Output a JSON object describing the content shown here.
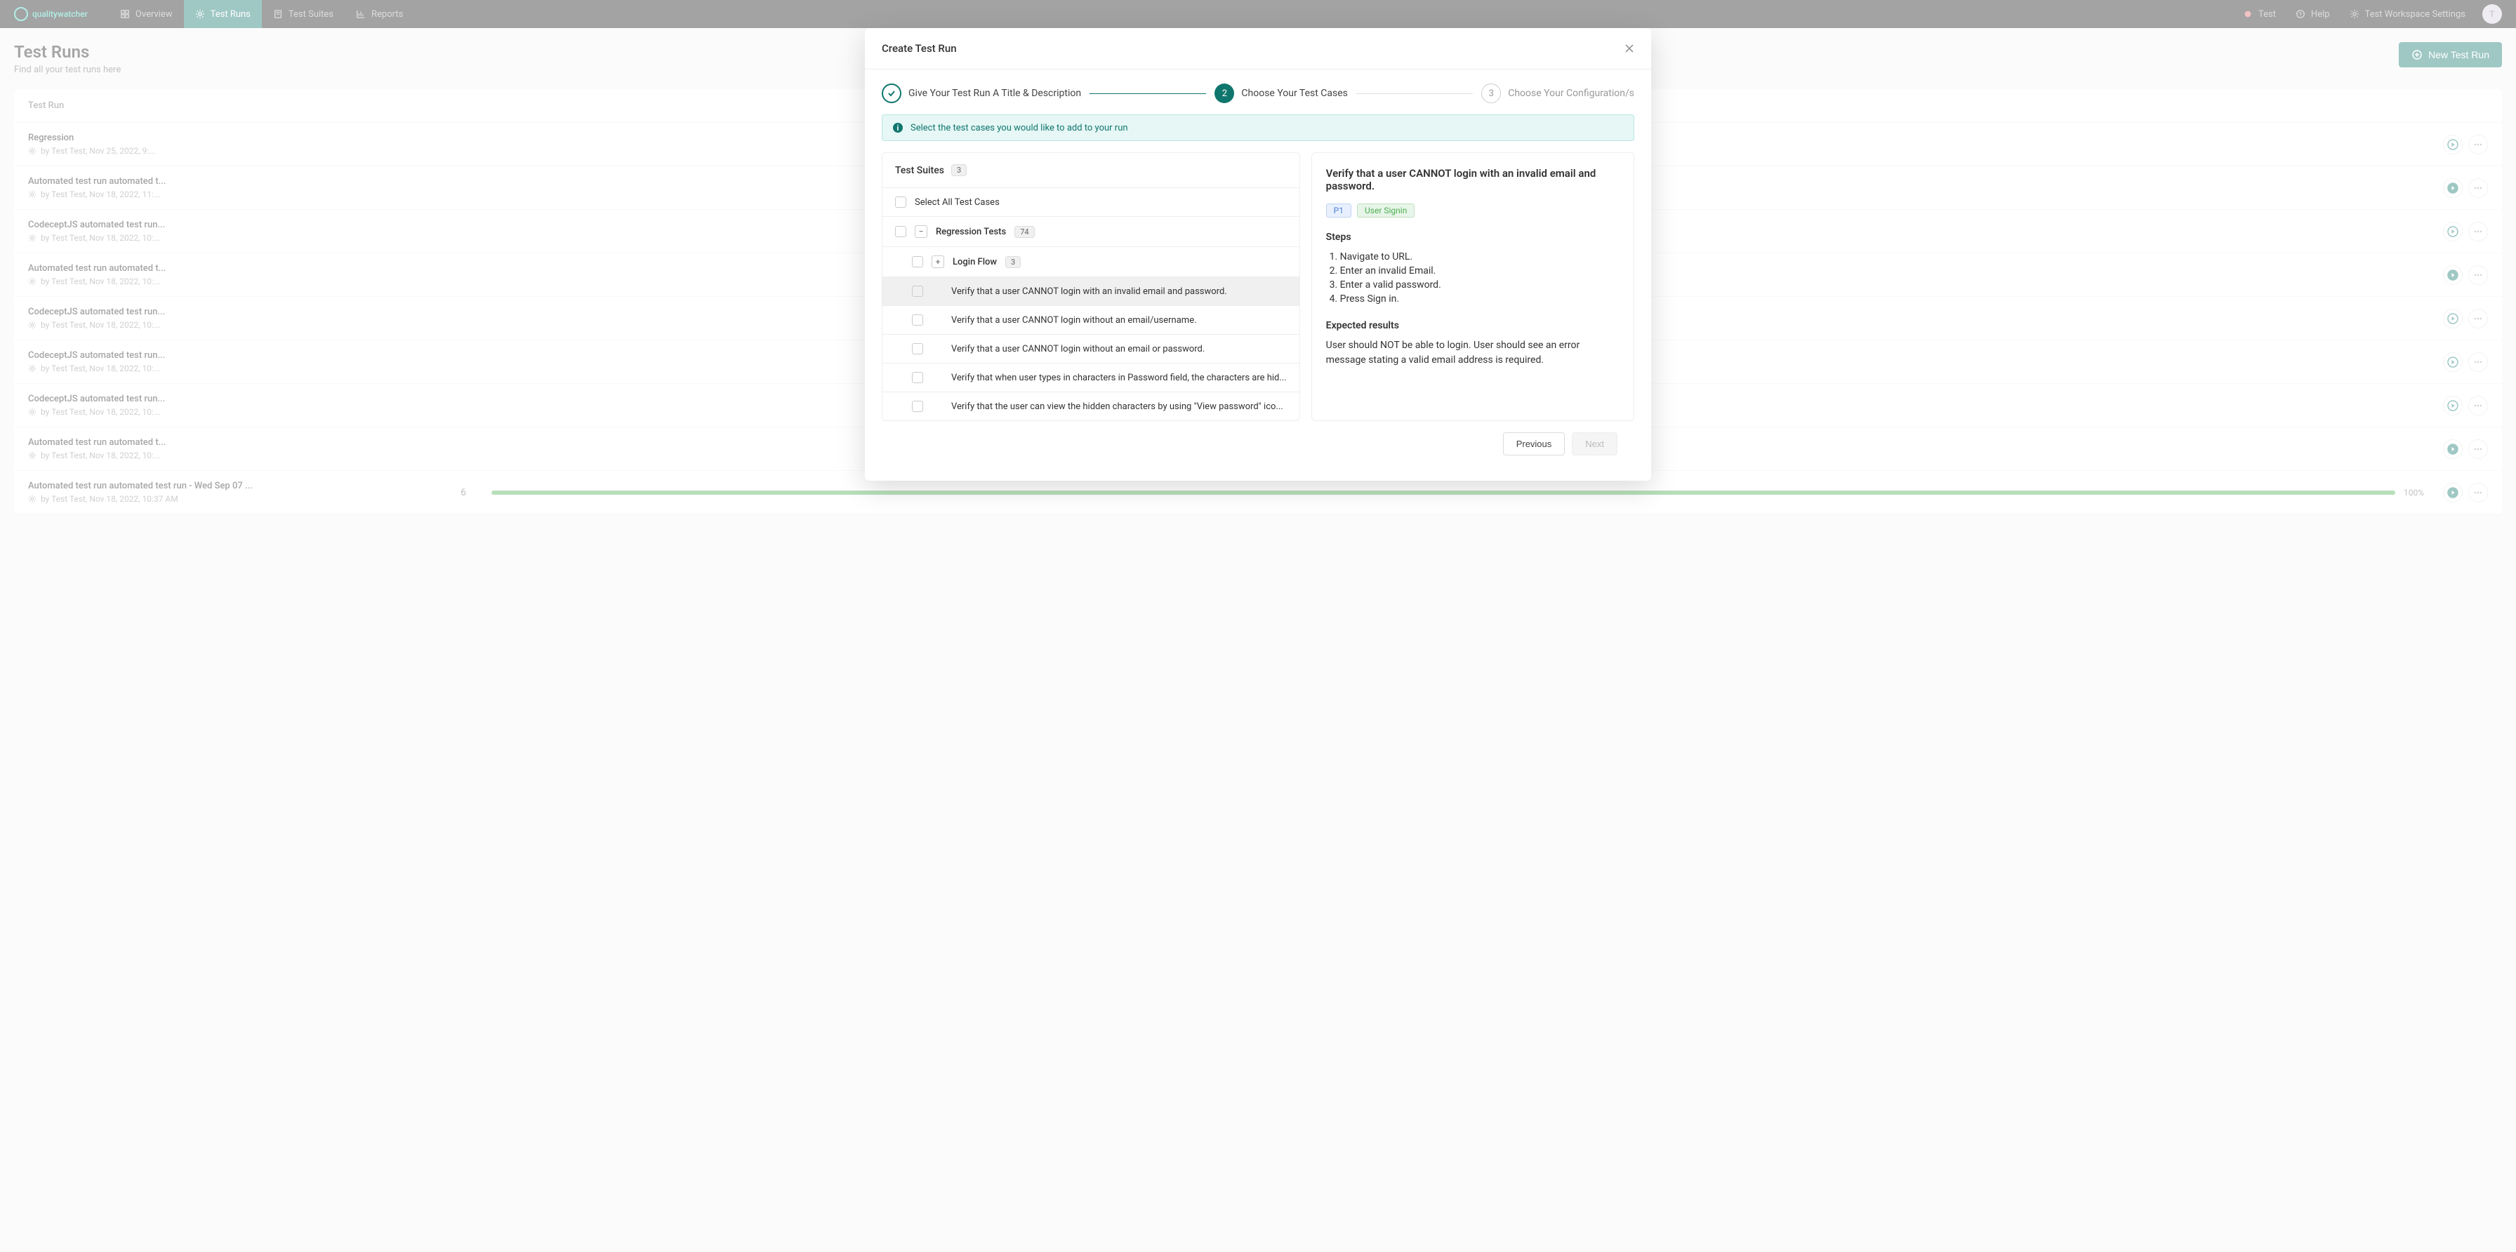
{
  "nav": {
    "logo": "qualitywatcher",
    "items": [
      {
        "label": "Overview",
        "active": false
      },
      {
        "label": "Test Runs",
        "active": true
      },
      {
        "label": "Test Suites",
        "active": false
      },
      {
        "label": "Reports",
        "active": false
      }
    ],
    "right": {
      "test": "Test",
      "help": "Help",
      "settings": "Test Workspace Settings",
      "avatar": "T"
    }
  },
  "page": {
    "title": "Test Runs",
    "subtitle": "Find all your test runs here",
    "new_run_btn": "New Test Run",
    "column_header": "Test Run"
  },
  "runs": [
    {
      "title": "Regression",
      "meta": "by Test Test, Nov 25, 2022, 9:...",
      "count": "",
      "pct": "",
      "play": "outline"
    },
    {
      "title": "Automated test run automated t...",
      "meta": "by Test Test, Nov 18, 2022, 11:...",
      "count": "",
      "pct": "",
      "play": "filled"
    },
    {
      "title": "CodeceptJS automated test run...",
      "meta": "by Test Test, Nov 18, 2022, 10:...",
      "count": "",
      "pct": "",
      "play": "outline"
    },
    {
      "title": "Automated test run automated t...",
      "meta": "by Test Test, Nov 18, 2022, 10:...",
      "count": "",
      "pct": "",
      "play": "filled"
    },
    {
      "title": "CodeceptJS automated test run...",
      "meta": "by Test Test, Nov 18, 2022, 10:...",
      "count": "",
      "pct": "",
      "play": "outline"
    },
    {
      "title": "CodeceptJS automated test run...",
      "meta": "by Test Test, Nov 18, 2022, 10:...",
      "count": "",
      "pct": "",
      "play": "outline"
    },
    {
      "title": "CodeceptJS automated test run...",
      "meta": "by Test Test, Nov 18, 2022, 10:...",
      "count": "",
      "pct": "",
      "play": "outline"
    },
    {
      "title": "Automated test run automated t...",
      "meta": "by Test Test, Nov 18, 2022, 10:...",
      "count": "",
      "pct": "",
      "play": "filled"
    },
    {
      "title": "Automated test run automated test run - Wed Sep 07 ...",
      "meta": "by Test Test, Nov 18, 2022, 10:37 AM",
      "count": "6",
      "pct": "100%",
      "play": "filled"
    }
  ],
  "modal": {
    "title": "Create Test Run",
    "steps": {
      "s1": "Give Your Test Run A Title & Description",
      "s2_num": "2",
      "s2": "Choose Your Test Cases",
      "s3_num": "3",
      "s3": "Choose Your Configuration/s"
    },
    "banner": "Select the test cases you would like to add to your run",
    "suites_label": "Test Suites",
    "suites_count": "3",
    "select_all": "Select All Test Cases",
    "tree": {
      "regression": {
        "label": "Regression Tests",
        "count": "74"
      },
      "login": {
        "label": "Login Flow",
        "count": "3"
      },
      "cases": [
        "Verify that a user CANNOT login with an invalid email and password.",
        "Verify that a user CANNOT login without an email/username.",
        "Verify that a user CANNOT login without an email or password.",
        "Verify that when user types in characters in Password field, the characters are hid...",
        "Verify that the user can view the hidden characters by using \"View password\" ico..."
      ]
    },
    "detail": {
      "title": "Verify that a user CANNOT login with an invalid email and password.",
      "priority": "P1",
      "category": "User Signin",
      "steps_label": "Steps",
      "steps": [
        "Navigate to URL.",
        "Enter an invalid Email.",
        "Enter a valid password.",
        "Press Sign in."
      ],
      "expected_label": "Expected results",
      "expected": "User should NOT be able to login. User should see an error message stating a valid email address is required."
    },
    "footer": {
      "prev": "Previous",
      "next": "Next"
    }
  }
}
